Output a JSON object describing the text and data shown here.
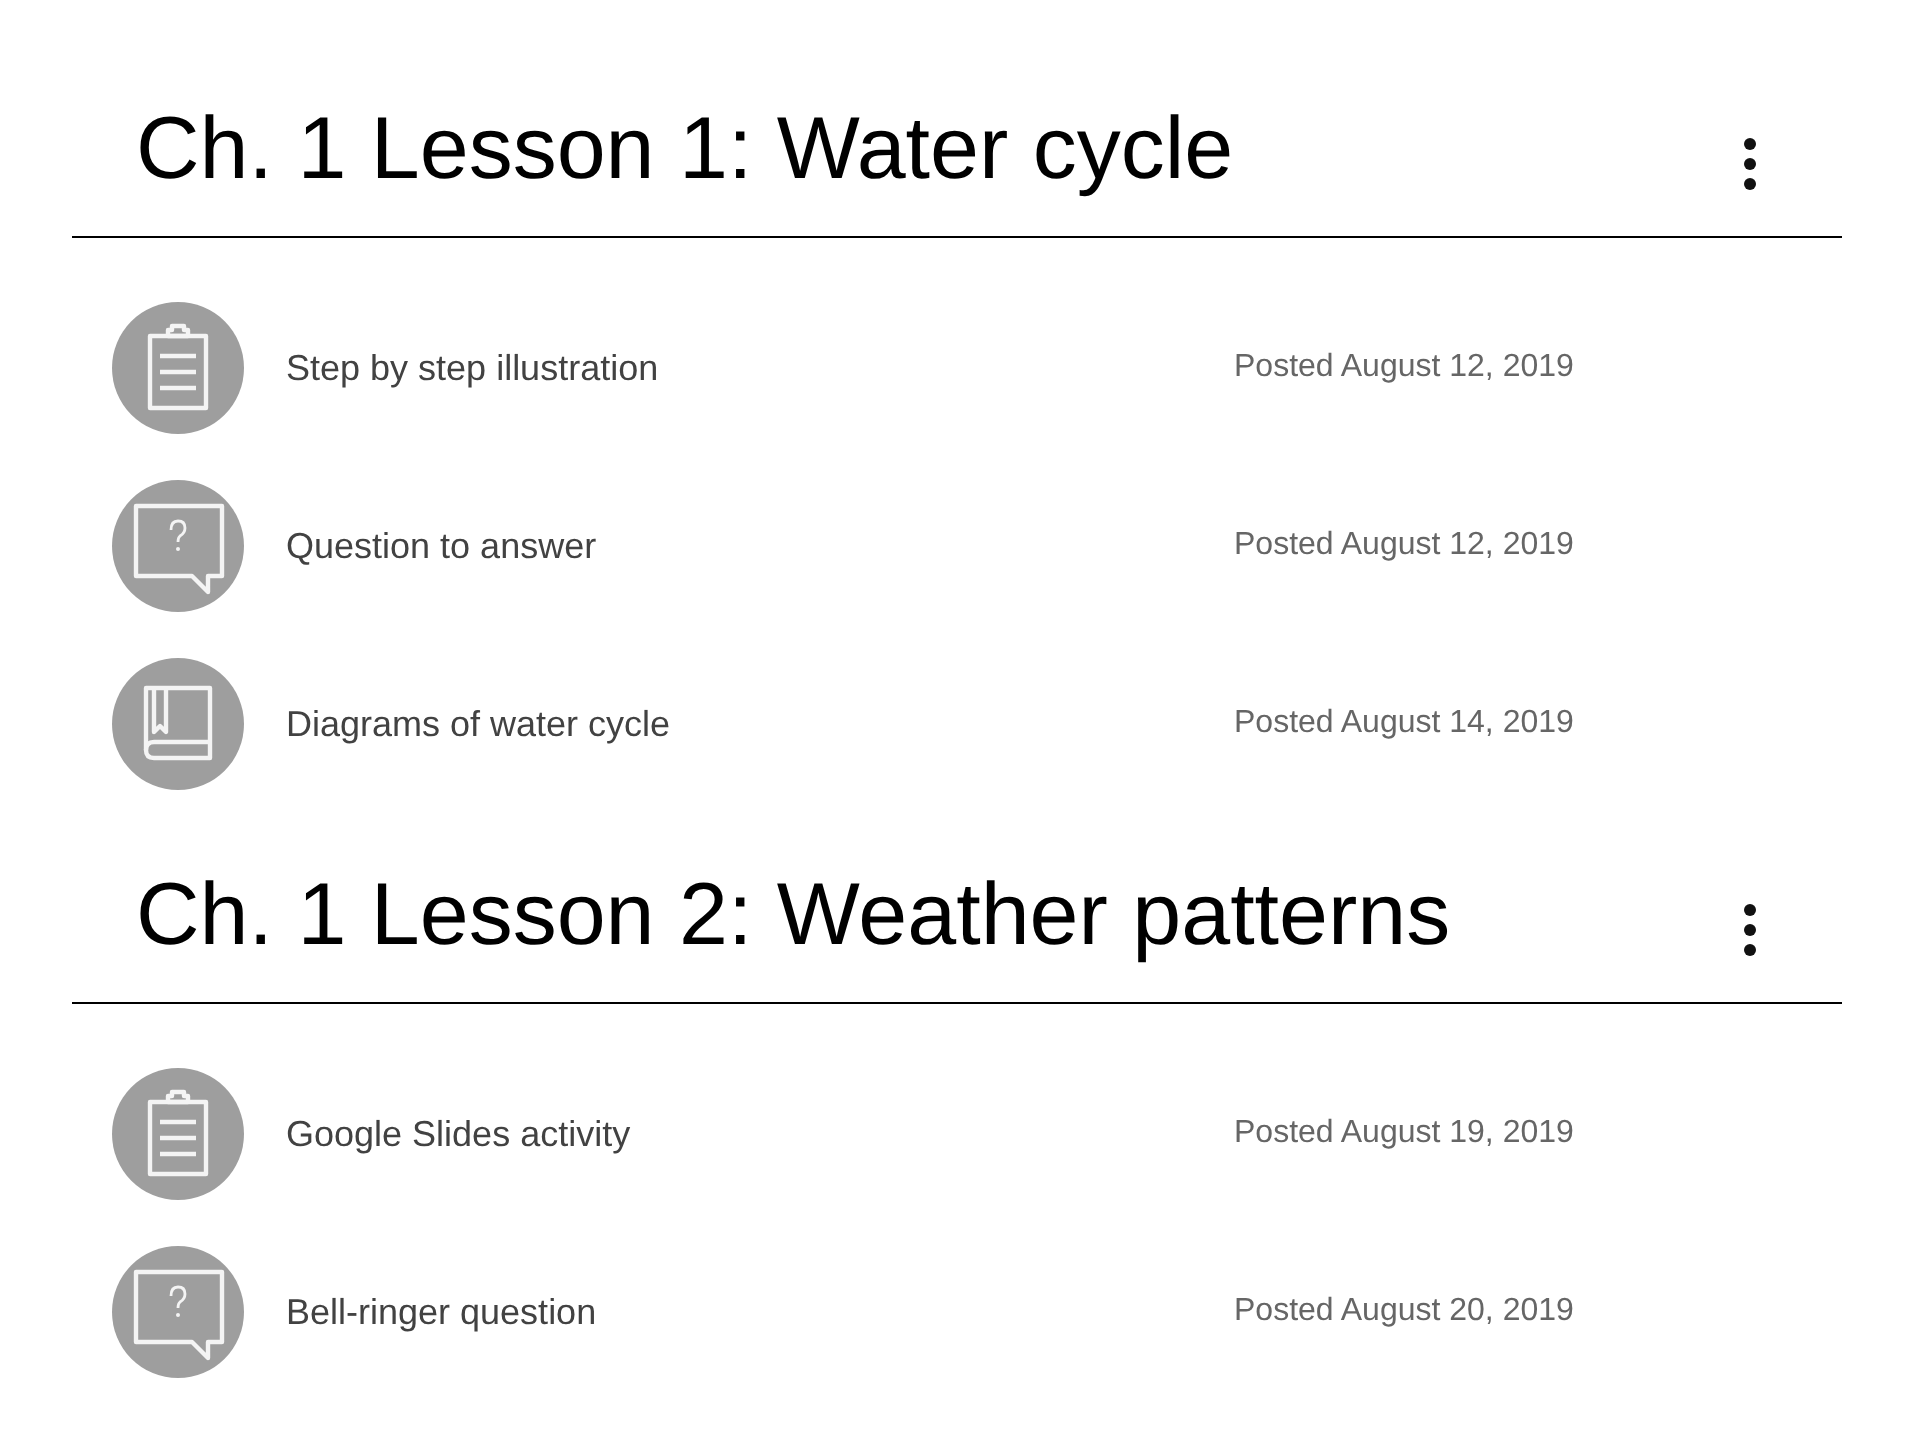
{
  "sections": [
    {
      "title": "Ch. 1 Lesson 1: Water cycle",
      "items": [
        {
          "kind": "assignment",
          "title": "Step by step illustration",
          "posted": "Posted August 12, 2019"
        },
        {
          "kind": "question",
          "title": "Question to answer",
          "posted": "Posted August 12, 2019"
        },
        {
          "kind": "material",
          "title": "Diagrams of water cycle",
          "posted": "Posted August 14, 2019"
        }
      ]
    },
    {
      "title": "Ch. 1 Lesson 2: Weather patterns",
      "items": [
        {
          "kind": "assignment",
          "title": "Google Slides activity",
          "posted": "Posted August 19, 2019"
        },
        {
          "kind": "question",
          "title": "Bell-ringer question",
          "posted": "Posted August 20, 2019"
        }
      ]
    }
  ]
}
